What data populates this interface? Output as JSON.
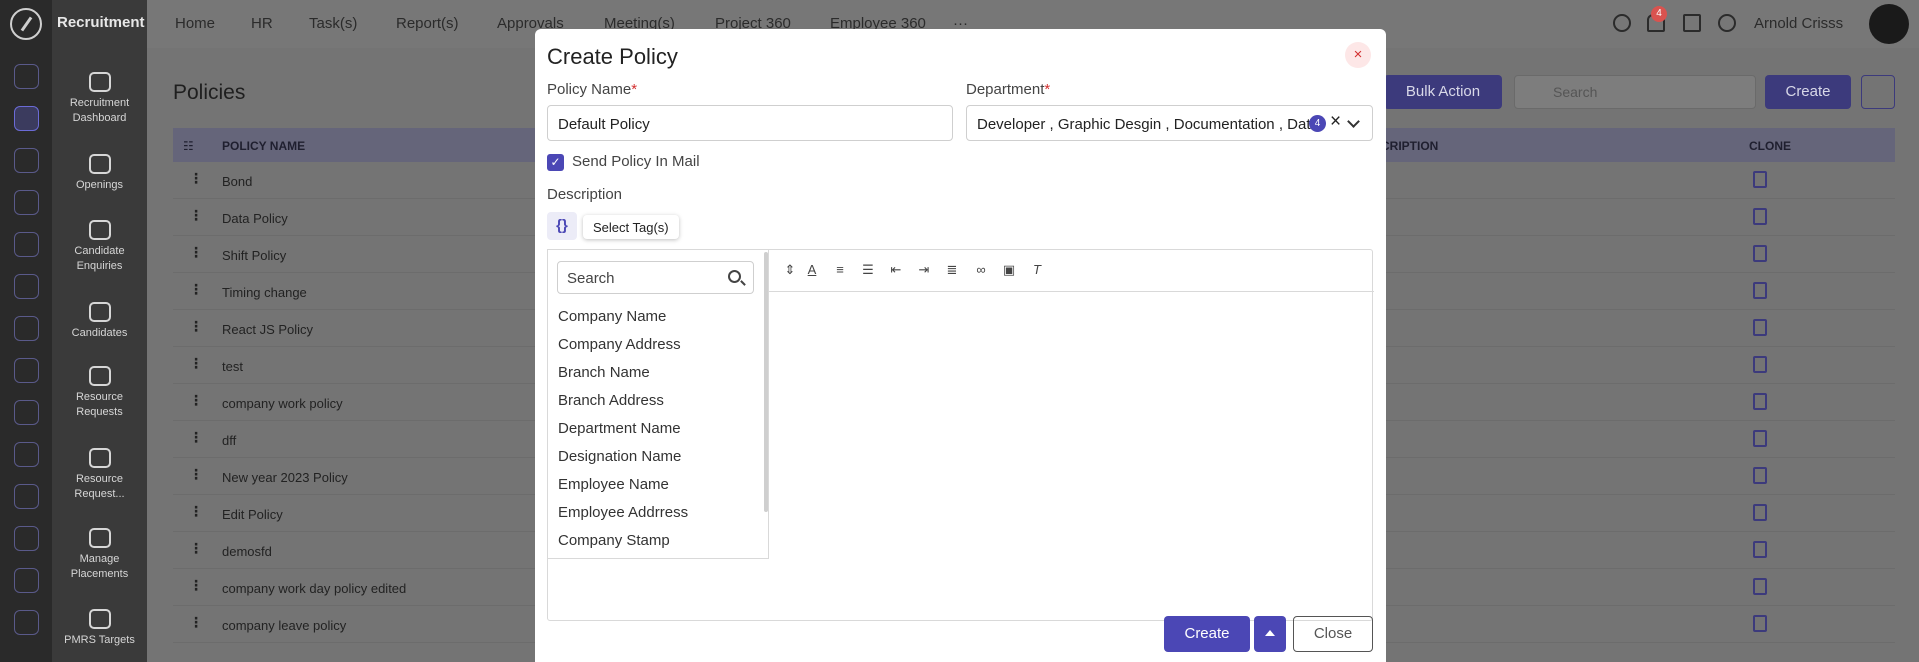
{
  "app": {
    "module_title": "Recruitment"
  },
  "sidebar": {
    "modules": [
      {
        "label": "Recruitment Dashboard",
        "icon": "dashboard-icon"
      },
      {
        "label": "Openings",
        "icon": "openings-icon"
      },
      {
        "label": "Candidate Enquiries",
        "icon": "phone-icon"
      },
      {
        "label": "Candidates",
        "icon": "candidates-icon"
      },
      {
        "label": "Resource Requests",
        "icon": "resource-icon"
      },
      {
        "label": "Resource Request...",
        "icon": "request-icon"
      },
      {
        "label": "Manage Placements",
        "icon": "placements-icon"
      },
      {
        "label": "PMRS Targets",
        "icon": "target-icon"
      }
    ]
  },
  "topnav": {
    "items": [
      "Home",
      "HR",
      "Task(s)",
      "Report(s)",
      "Approvals",
      "Meeting(s)",
      "Project 360",
      "Employee 360"
    ],
    "more": "···",
    "notification_count": "4",
    "user_name": "Arnold Crisss"
  },
  "page": {
    "title": "Policies",
    "bulk_action": "Bulk Action",
    "search_placeholder": "Search",
    "create": "Create",
    "columns": {
      "name": "POLICY NAME",
      "description": "SCRIPTION",
      "clone": "CLONE"
    },
    "rows": [
      "Bond",
      "Data Policy",
      "Shift Policy",
      "Timing change",
      "React JS Policy",
      "test",
      "company work policy",
      "dff",
      "New year 2023 Policy",
      "Edit Policy",
      "demosfd",
      "company work day policy edited",
      "company leave policy"
    ]
  },
  "modal": {
    "title": "Create Policy",
    "close_icon": "×",
    "policy_name_label": "Policy Name",
    "policy_name_value": "Default Policy",
    "department_label": "Department",
    "department_value": "Developer , Graphic Desgin , Documentation , Dat",
    "department_count": "4",
    "send_mail_label": "Send Policy In Mail",
    "description_label": "Description",
    "tag_button": "{}",
    "tag_tooltip": "Select Tag(s)",
    "tag_search_placeholder": "Search",
    "tags": [
      "Company Name",
      "Company Address",
      "Branch Name",
      "Branch Address",
      "Department Name",
      "Designation Name",
      "Employee Name",
      "Employee Addrress",
      "Company Stamp"
    ],
    "toolbar_icons": [
      "font-size-icon",
      "font-color-icon",
      "ordered-list-icon",
      "bullet-list-icon",
      "outdent-icon",
      "indent-icon",
      "align-icon",
      "link-icon",
      "image-icon",
      "clear-format-icon"
    ],
    "create_button": "Create",
    "close_button": "Close"
  },
  "colors": {
    "primary": "#4b47b5",
    "danger": "#d32f2f"
  }
}
